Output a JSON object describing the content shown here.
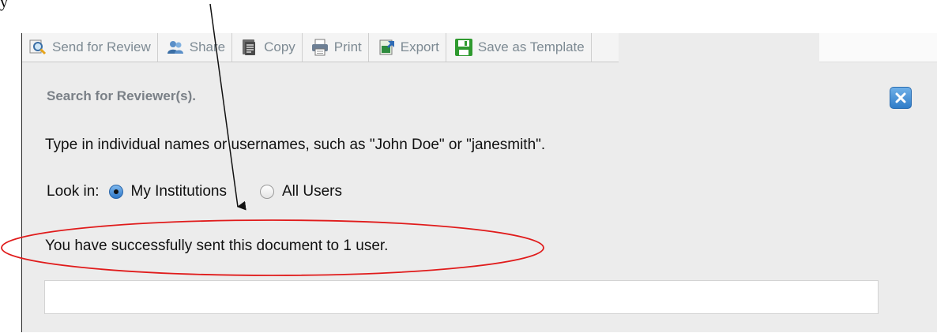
{
  "caption_text": "y",
  "toolbar": {
    "send_for_review": "Send for Review",
    "share": "Share",
    "copy": "Copy",
    "print": "Print",
    "export": "Export",
    "save_as_template": "Save as Template"
  },
  "panel": {
    "title": "Search for Reviewer(s).",
    "instructions": "Type in individual names or usernames, such as \"John Doe\" or \"janesmith\".",
    "look_in_label": "Look in:",
    "options": [
      {
        "label": "My Institutions",
        "selected": true
      },
      {
        "label": "All Users",
        "selected": false
      }
    ],
    "success_message": "You have successfully sent this document to 1 user.",
    "search_value": "",
    "close_icon": "close-icon"
  },
  "colors": {
    "toolbar_text": "#7d8a93",
    "accent_blue": "#2f7cc8",
    "annotation_red": "#e01b1b"
  }
}
